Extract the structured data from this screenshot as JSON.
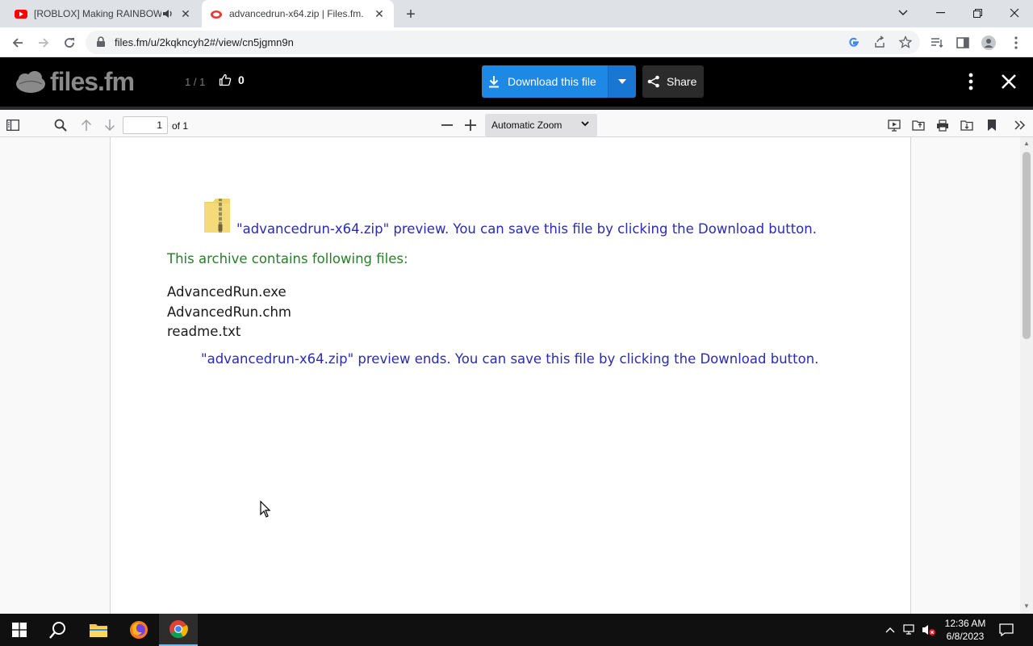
{
  "browser": {
    "tabs": [
      {
        "title": "[ROBLOX] Making RAINBOW",
        "favicon": "youtube-icon",
        "audio": true,
        "active": false
      },
      {
        "title": "advancedrun-x64.zip | Files.fm.",
        "favicon": "filesfm-icon",
        "audio": false,
        "active": true
      }
    ],
    "url": "files.fm/u/2kqkncyh2#/view/cn5jgmn9n"
  },
  "header": {
    "logo_text": "files.fm",
    "page_counter": "1 / 1",
    "likes": "0",
    "download_label": "Download this file",
    "share_label": "Share"
  },
  "pdf_toolbar": {
    "page_number": "1",
    "page_total": "of 1",
    "zoom": "Automatic Zoom"
  },
  "document": {
    "intro": "\"advancedrun-x64.zip\" preview. You can save this file by clicking the Download button.",
    "contains_label": "This archive contains following files:",
    "files": [
      "AdvancedRun.exe",
      "AdvancedRun.chm",
      "readme.txt"
    ],
    "ends": "\"advancedrun-x64.zip\" preview ends. You can save this file by clicking the Download button."
  },
  "taskbar": {
    "time": "12:36 AM",
    "date": "6/8/2023"
  },
  "colors": {
    "link_blue": "#2b2bb0",
    "heading_green": "#2a7d2a",
    "download_blue": "#1e88e5",
    "header_bg": "#000000"
  }
}
